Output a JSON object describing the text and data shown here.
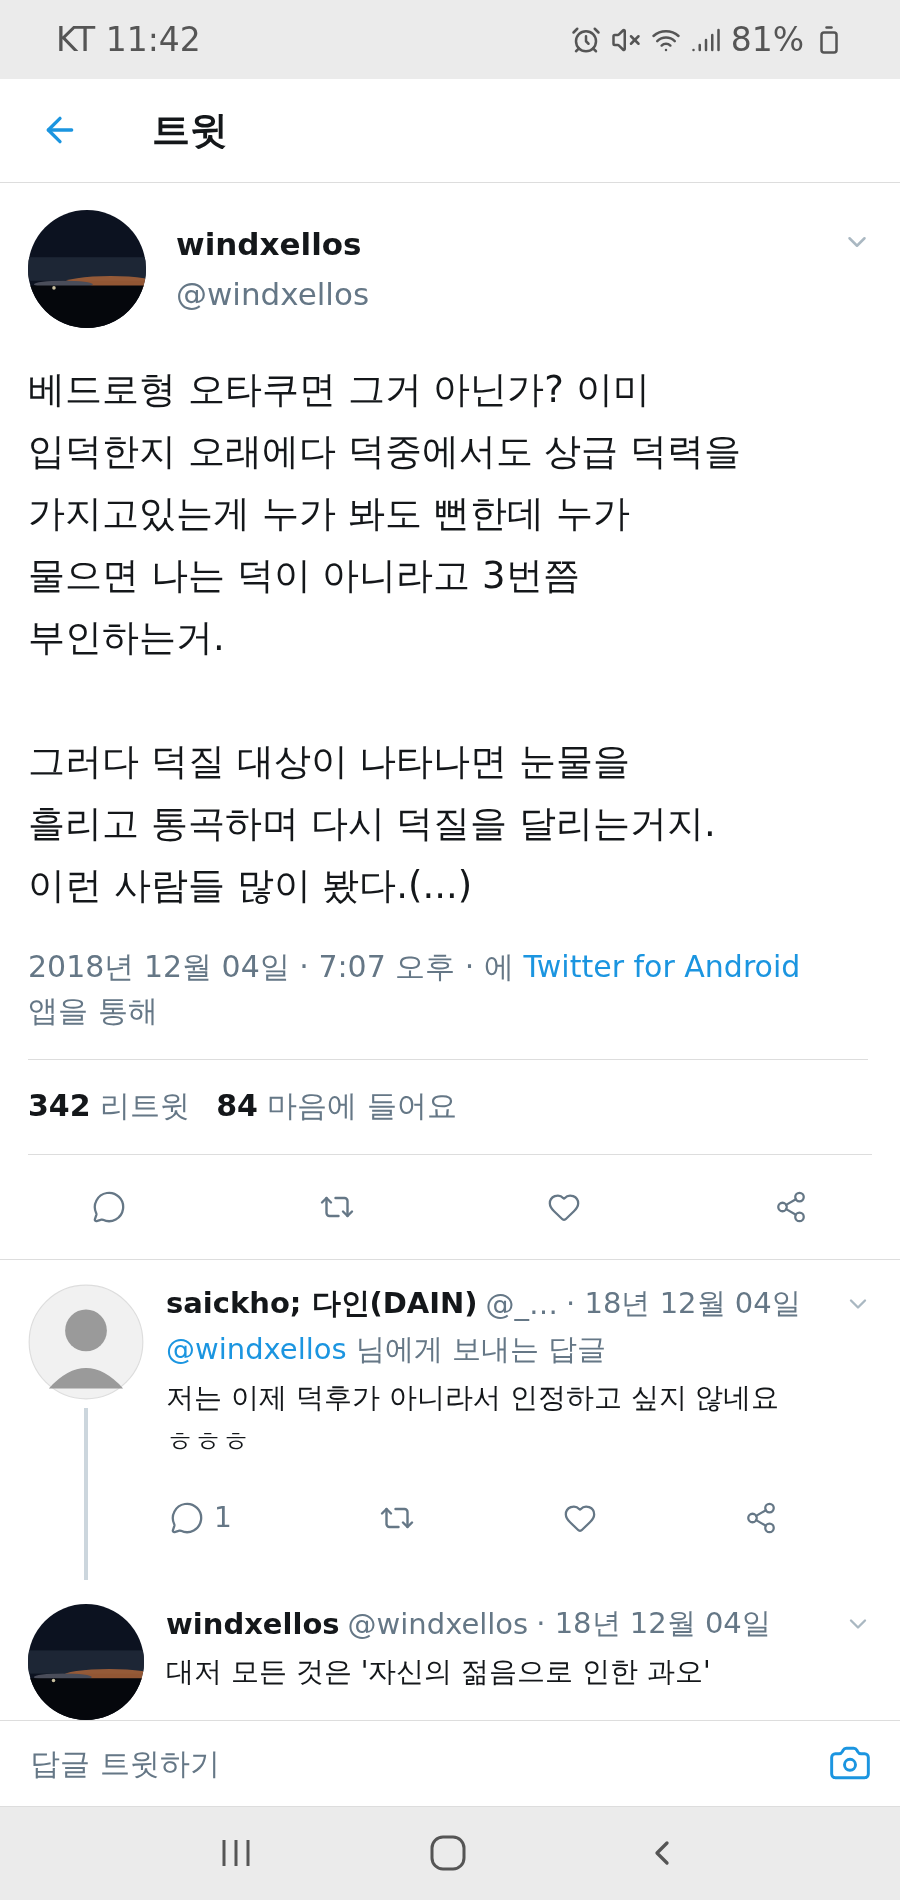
{
  "status_bar": {
    "carrier_time": "KT 11:42",
    "battery": "81%"
  },
  "header": {
    "title": "트윗"
  },
  "tweet": {
    "name": "windxellos",
    "handle": "@windxellos",
    "paragraphs": [
      "베드로형 오타쿠면 그거 아닌가? 이미\n입덕한지 오래에다 덕중에서도 상급 덕력을\n가지고있는게 누가 봐도 뻔한데 누가\n물으면 나는 덕이 아니라고 3번쯤\n부인하는거.",
      "그러다 덕질 대상이 나타나면 눈물을\n흘리고 통곡하며 다시 덕질을 달리는거지.\n이런 사람들 많이 봤다.(...)"
    ],
    "timestamp": "2018년 12월 04일 · 7:07 오후 · 에",
    "source": "Twitter for Android",
    "source_suffix": "앱을 통해",
    "stats": [
      {
        "count": "342",
        "label": "리트윗"
      },
      {
        "count": "84",
        "label": "마음에 들어요"
      }
    ]
  },
  "replies": [
    {
      "avatar": {
        "kind": "sketch"
      },
      "thread_line": true,
      "name": "saickho; 다인(DAIN)",
      "handle": "@_…",
      "date": "· 18년 12월 04일",
      "reply_to": "@windxellos",
      "reply_to_suffix": "님에게 보내는 답글",
      "text": "저는 이제 덕후가 아니라서 인정하고 싶지 않네요\nㅎㅎㅎ",
      "reply_count": "1"
    },
    {
      "thread_line": false,
      "name": "windxellos",
      "handle": "@windxellos",
      "date": "· 18년 12월 04일",
      "text": "대저 모든 것은 '자신의 젊음으로 인한 과오'"
    }
  ],
  "reply_bar": {
    "placeholder": "답글 트윗하기"
  }
}
